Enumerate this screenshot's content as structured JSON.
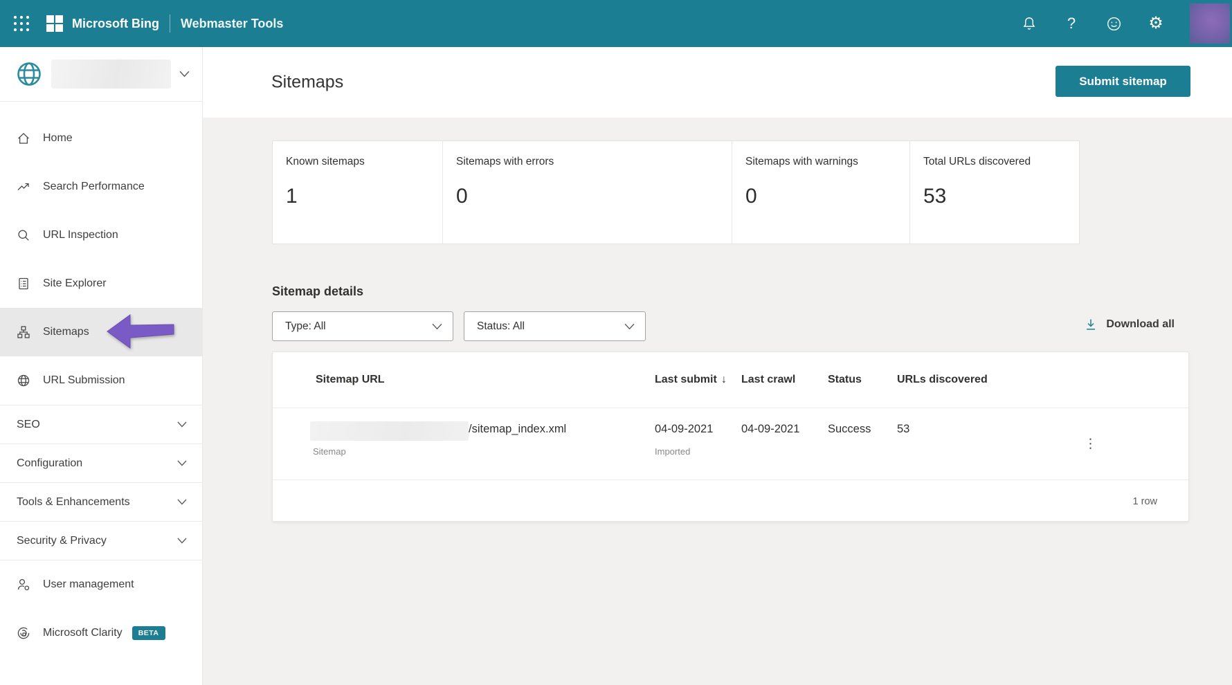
{
  "topbar": {
    "brand": "Microsoft Bing",
    "product": "Webmaster Tools"
  },
  "icons": {
    "help_glyph": "?",
    "gear_glyph": "⚙",
    "kebab_glyph": "⋮",
    "sort_glyph": "↓"
  },
  "sidebar": {
    "items": [
      {
        "label": "Home",
        "selected": false
      },
      {
        "label": "Search Performance",
        "selected": false
      },
      {
        "label": "URL Inspection",
        "selected": false
      },
      {
        "label": "Site Explorer",
        "selected": false
      },
      {
        "label": "Sitemaps",
        "selected": true
      },
      {
        "label": "URL Submission",
        "selected": false
      }
    ],
    "sections": [
      {
        "label": "SEO"
      },
      {
        "label": "Configuration"
      },
      {
        "label": "Tools & Enhancements"
      },
      {
        "label": "Security & Privacy"
      }
    ],
    "footer": [
      {
        "label": "User management"
      },
      {
        "label": "Microsoft Clarity",
        "badge": "BETA"
      }
    ]
  },
  "page": {
    "title": "Sitemaps",
    "submit_button": "Submit sitemap"
  },
  "stats": [
    {
      "label": "Known sitemaps",
      "value": "1"
    },
    {
      "label": "Sitemaps with errors",
      "value": "0"
    },
    {
      "label": "Sitemaps with warnings",
      "value": "0"
    },
    {
      "label": "Total URLs discovered",
      "value": "53"
    }
  ],
  "details": {
    "heading": "Sitemap details",
    "type_filter": "Type: All",
    "status_filter": "Status: All",
    "download_all": "Download all"
  },
  "table": {
    "columns": [
      "Sitemap URL",
      "Last submit",
      "Last crawl",
      "Status",
      "URLs discovered"
    ],
    "sort_column": "Last submit",
    "rows": [
      {
        "url_path": "/sitemap_index.xml",
        "url_type": "Sitemap",
        "last_submit": "04-09-2021",
        "last_submit_note": "Imported",
        "last_crawl": "04-09-2021",
        "status": "Success",
        "urls_discovered": "53"
      }
    ],
    "footer": "1 row"
  },
  "colors": {
    "accent_teal": "#1b7e92",
    "arrow_purple": "#7a5bc5",
    "selected_bg": "#e9e8e8",
    "content_bg": "#f2f1ef"
  }
}
